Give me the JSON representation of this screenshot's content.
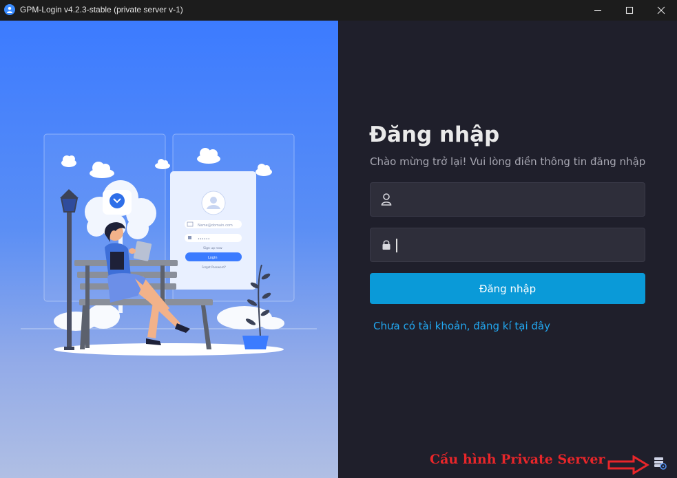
{
  "window": {
    "title": "GPM-Login v4.2.3-stable (private server v-1)"
  },
  "illustration": {
    "form_username_placeholder": "Name@domain.com",
    "form_password_mask": "••••••",
    "form_signup_text": "Sign up now",
    "form_login_label": "Login",
    "form_forgot_text": "Forgot Password?"
  },
  "login": {
    "heading": "Đăng nhập",
    "subheading": "Chào mừng trở lại! Vui lòng điền thông tin đăng nhập",
    "username_value": "",
    "password_value": "",
    "submit_label": "Đăng nhập",
    "register_link": "Chưa có tài khoản, đăng kí tại đây"
  },
  "annotation": {
    "private_server_text": "Cấu hình Private Server"
  },
  "colors": {
    "accent": "#0a9ad8",
    "link": "#22a7f0",
    "annotation_red": "#e8262a"
  }
}
